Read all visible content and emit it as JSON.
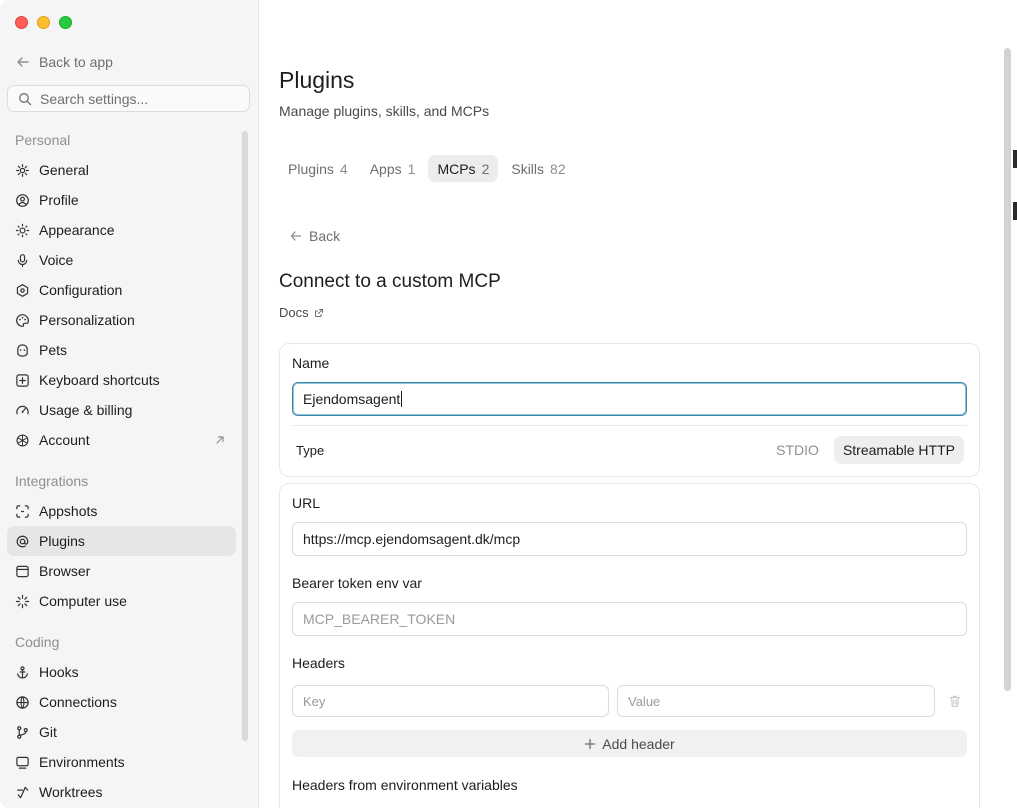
{
  "sidebar": {
    "back_label": "Back to app",
    "search_placeholder": "Search settings...",
    "sections": {
      "personal": "Personal",
      "integrations": "Integrations",
      "coding": "Coding"
    },
    "items": {
      "general": "General",
      "profile": "Profile",
      "appearance": "Appearance",
      "voice": "Voice",
      "configuration": "Configuration",
      "personalization": "Personalization",
      "pets": "Pets",
      "keyboard": "Keyboard shortcuts",
      "usage": "Usage & billing",
      "account": "Account",
      "appshots": "Appshots",
      "plugins": "Plugins",
      "browser": "Browser",
      "computer_use": "Computer use",
      "hooks": "Hooks",
      "connections": "Connections",
      "git": "Git",
      "environments": "Environments",
      "worktrees": "Worktrees"
    },
    "active_item": "Plugins"
  },
  "page": {
    "title": "Plugins",
    "subtitle": "Manage plugins, skills, and MCPs",
    "tabs": [
      {
        "label": "Plugins",
        "count": "4"
      },
      {
        "label": "Apps",
        "count": "1"
      },
      {
        "label": "MCPs",
        "count": "2"
      },
      {
        "label": "Skills",
        "count": "82"
      }
    ],
    "active_tab": "MCPs",
    "back_label": "Back",
    "heading": "Connect to a custom MCP",
    "docs_label": "Docs"
  },
  "form": {
    "name_label": "Name",
    "name_value": "Ejendomsagent",
    "type_label": "Type",
    "type_options": [
      "STDIO",
      "Streamable HTTP"
    ],
    "type_selected": "Streamable HTTP",
    "url_label": "URL",
    "url_value": "https://mcp.ejendomsagent.dk/mcp",
    "bearer_label": "Bearer token env var",
    "bearer_placeholder": "MCP_BEARER_TOKEN",
    "headers_label": "Headers",
    "key_placeholder": "Key",
    "value_placeholder": "Value",
    "add_header_label": "Add header",
    "env_headers_label": "Headers from environment variables"
  }
}
